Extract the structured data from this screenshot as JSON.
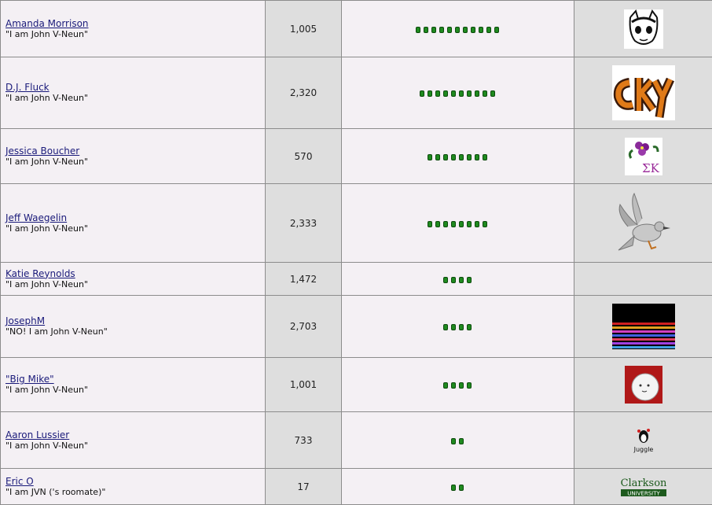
{
  "rows": [
    {
      "name": "Amanda Morrison",
      "title": "\"I am John V-Neun\"",
      "posts": "1,005",
      "pips": 11,
      "avatar": "sketch-face-avatar"
    },
    {
      "name": "D.J. Fluck",
      "title": "\"I am John V-Neun\"",
      "posts": "2,320",
      "pips": 10,
      "avatar": "cky-logo-avatar"
    },
    {
      "name": "Jessica Boucher",
      "title": "\"I am John V-Neun\"",
      "posts": "570",
      "pips": 8,
      "avatar": "sigma-kappa-violet-avatar",
      "avatar_text": "ΣΚ"
    },
    {
      "name": "Jeff Waegelin",
      "title": "\"I am John V-Neun\"",
      "posts": "2,333",
      "pips": 8,
      "avatar": "bird-avatar"
    },
    {
      "name": "Katie Reynolds",
      "title": "\"I am John V-Neun\"",
      "posts": "1,472",
      "pips": 4,
      "avatar": ""
    },
    {
      "name": "JosephM",
      "title": "\"NO! I am John V-Neun\"",
      "posts": "2,703",
      "pips": 4,
      "avatar": "color-stripes-avatar"
    },
    {
      "name": "\"Big Mike\"",
      "title": "\"I am John V-Neun\"",
      "posts": "1,001",
      "pips": 4,
      "avatar": "ghost-face-avatar"
    },
    {
      "name": "Aaron Lussier",
      "title": "\"I am John V-Neun\"",
      "posts": "733",
      "pips": 2,
      "avatar": "juggle-penguin-avatar",
      "avatar_text": "Juggle"
    },
    {
      "name": "Eric O",
      "title": "\"I am JVN ('s roomate)\"",
      "posts": "17",
      "pips": 2,
      "avatar": "clarkson-university-logo-avatar",
      "avatar_text": "Clarkson",
      "avatar_subtext": "UNIVERSITY"
    }
  ],
  "colors": {
    "pip": "#1f8a1f",
    "user_bg": "#f4f0f4",
    "alt_bg": "#dedede",
    "link": "#1a1a7a"
  }
}
